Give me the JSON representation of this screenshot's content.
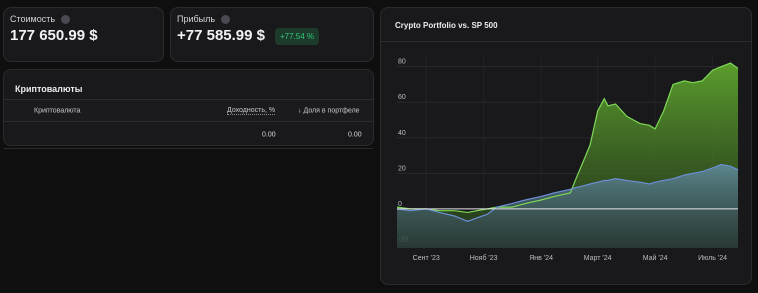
{
  "stats": {
    "value": {
      "label": "Стоимость",
      "amount": "177 650.99 $"
    },
    "profit": {
      "label": "Прибыль",
      "amount": "+77 585.99 $",
      "badge": "+77.54 %"
    }
  },
  "crypto_table": {
    "title": "Криптовалюты",
    "columns": {
      "name": "Криптовалюта",
      "yield": "Доходность, %",
      "share": "Доля в портфеле"
    },
    "rows": [
      {
        "name": "",
        "yield": "0.00",
        "share": "0.00"
      }
    ]
  },
  "chart_title": "Crypto Portfolio vs. SP 500",
  "colors": {
    "crypto": "#7ed957",
    "sp500": "#6b8fd6",
    "background": "#19191b",
    "badge_text": "#35c57a"
  },
  "chart_data": {
    "type": "area",
    "title": "Crypto Portfolio vs. SP 500",
    "x_ticks": [
      "Сент '23",
      "Нояб '23",
      "Янв '24",
      "Март '24",
      "Май '24",
      "Июль '24"
    ],
    "y_ticks": [
      "80",
      "60",
      "40",
      "20",
      "0",
      "-20"
    ],
    "ylim": [
      -22,
      86
    ],
    "grid": true,
    "x": [
      "2023-08-01",
      "2023-08-15",
      "2023-09-01",
      "2023-09-15",
      "2023-10-01",
      "2023-10-15",
      "2023-10-25",
      "2023-11-05",
      "2023-11-15",
      "2023-12-01",
      "2023-12-15",
      "2024-01-01",
      "2024-01-15",
      "2024-02-01",
      "2024-02-07",
      "2024-02-15",
      "2024-02-22",
      "2024-03-01",
      "2024-03-08",
      "2024-03-12",
      "2024-03-20",
      "2024-04-01",
      "2024-04-15",
      "2024-04-25",
      "2024-05-01",
      "2024-05-10",
      "2024-05-20",
      "2024-06-01",
      "2024-06-10",
      "2024-06-20",
      "2024-07-01",
      "2024-07-10",
      "2024-07-20",
      "2024-07-28"
    ],
    "series": [
      {
        "values": [
          1,
          0,
          0,
          -1,
          -1,
          -2,
          -1,
          0,
          1,
          1,
          3,
          5,
          7,
          9,
          17,
          27,
          36,
          55,
          62,
          58,
          59,
          52,
          48,
          47,
          45,
          55,
          70,
          72,
          71,
          72,
          78,
          80,
          82,
          79
        ]
      },
      {
        "values": [
          0,
          -1,
          0,
          -2,
          -4,
          -7,
          -5,
          -3,
          1,
          3,
          5,
          7,
          9,
          11,
          12,
          13,
          14,
          15,
          16,
          16,
          17,
          16,
          15,
          14,
          15,
          16,
          17,
          19,
          20,
          21,
          23,
          25,
          24,
          22
        ]
      }
    ]
  }
}
